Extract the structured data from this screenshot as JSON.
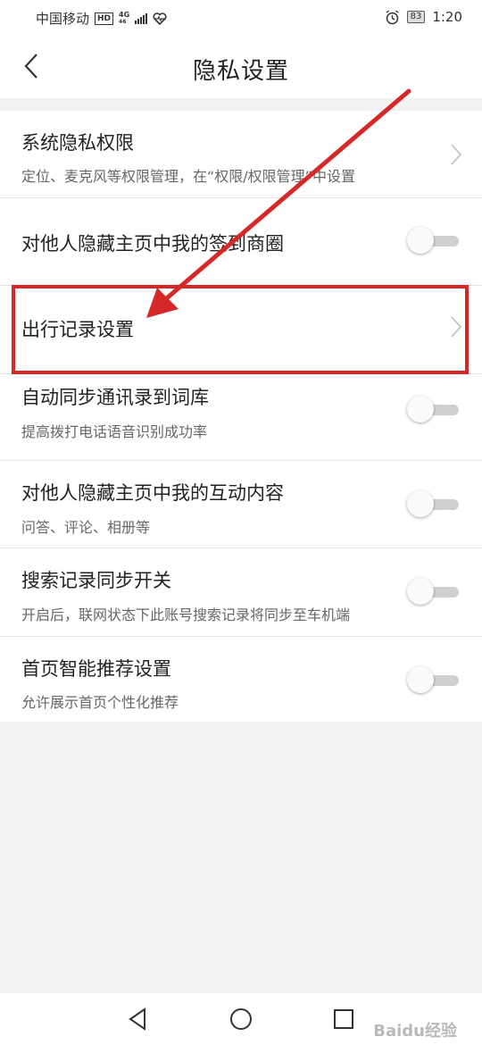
{
  "status_bar": {
    "carrier": "中国移动",
    "hd": "HD",
    "network": "4G",
    "battery": "83",
    "time": "1:20"
  },
  "header": {
    "title": "隐私设置"
  },
  "rows": [
    {
      "title": "系统隐私权限",
      "subtitle": "定位、麦克风等权限管理，在“权限/权限管理”中设置",
      "control": "chevron"
    },
    {
      "title": "对他人隐藏主页中我的签到商圈",
      "subtitle": "",
      "control": "toggle",
      "on": false
    },
    {
      "title": "出行记录设置",
      "subtitle": "",
      "control": "chevron"
    },
    {
      "title": "自动同步通讯录到词库",
      "subtitle": "提高拨打电话语音识别成功率",
      "control": "toggle",
      "on": false
    },
    {
      "title": "对他人隐藏主页中我的互动内容",
      "subtitle": "问答、评论、相册等",
      "control": "toggle",
      "on": false
    },
    {
      "title": "搜索记录同步开关",
      "subtitle": "开启后，联网状态下此账号搜索记录将同步至车机端",
      "control": "toggle",
      "on": false
    },
    {
      "title": "首页智能推荐设置",
      "subtitle": "允许展示首页个性化推荐",
      "control": "toggle",
      "on": false
    }
  ],
  "annotation": {
    "color": "#d62828"
  },
  "nav": {
    "back_icon": "triangle-back-icon",
    "home_icon": "circle-home-icon",
    "recents_icon": "square-recents-icon"
  },
  "watermark": "Baidu经验"
}
